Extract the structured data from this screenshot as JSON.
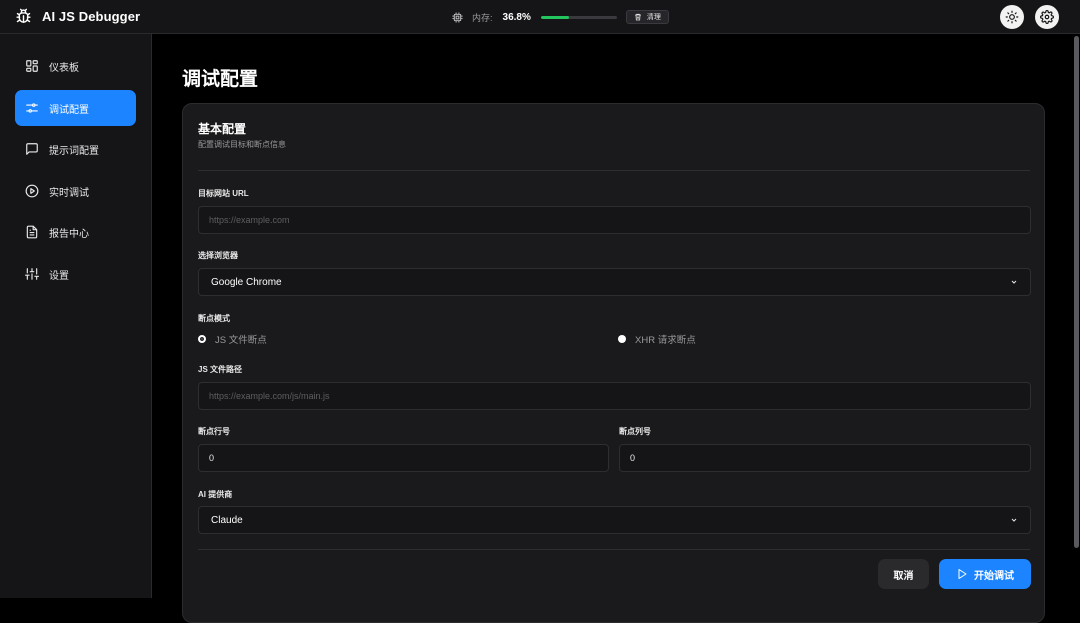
{
  "app": {
    "title": "AI JS Debugger"
  },
  "memory": {
    "label": "内存:",
    "value": "36.8%",
    "percent": 36.8,
    "clear_label": "清理"
  },
  "sidebar": {
    "items": [
      {
        "label": "仪表板",
        "icon": "dashboard-icon",
        "active": false
      },
      {
        "label": "调试配置",
        "icon": "sliders-icon",
        "active": true
      },
      {
        "label": "提示词配置",
        "icon": "message-icon",
        "active": false
      },
      {
        "label": "实时调试",
        "icon": "play-circle-icon",
        "active": false
      },
      {
        "label": "报告中心",
        "icon": "file-text-icon",
        "active": false
      },
      {
        "label": "设置",
        "icon": "settings-sliders-icon",
        "active": false
      }
    ]
  },
  "page": {
    "title": "调试配置"
  },
  "card": {
    "title": "基本配置",
    "subtitle": "配置调试目标和断点信息"
  },
  "form": {
    "url_label": "目标网站 URL",
    "url_placeholder": "https://example.com",
    "browser_label": "选择浏览器",
    "browser_value": "Google Chrome",
    "mode_label": "断点模式",
    "mode_js": "JS 文件断点",
    "mode_xhr": "XHR 请求断点",
    "js_path_label": "JS 文件路径",
    "js_path_placeholder": "https://example.com/js/main.js",
    "line_label": "断点行号",
    "line_value": "0",
    "col_label": "断点列号",
    "col_value": "0",
    "ai_label": "AI 提供商",
    "ai_value": "Claude"
  },
  "actions": {
    "cancel": "取消",
    "start": "开始调试"
  },
  "colors": {
    "accent": "#1c84ff",
    "memory": "#22c55e",
    "background": "#000000",
    "panel": "#1a1a1c"
  }
}
